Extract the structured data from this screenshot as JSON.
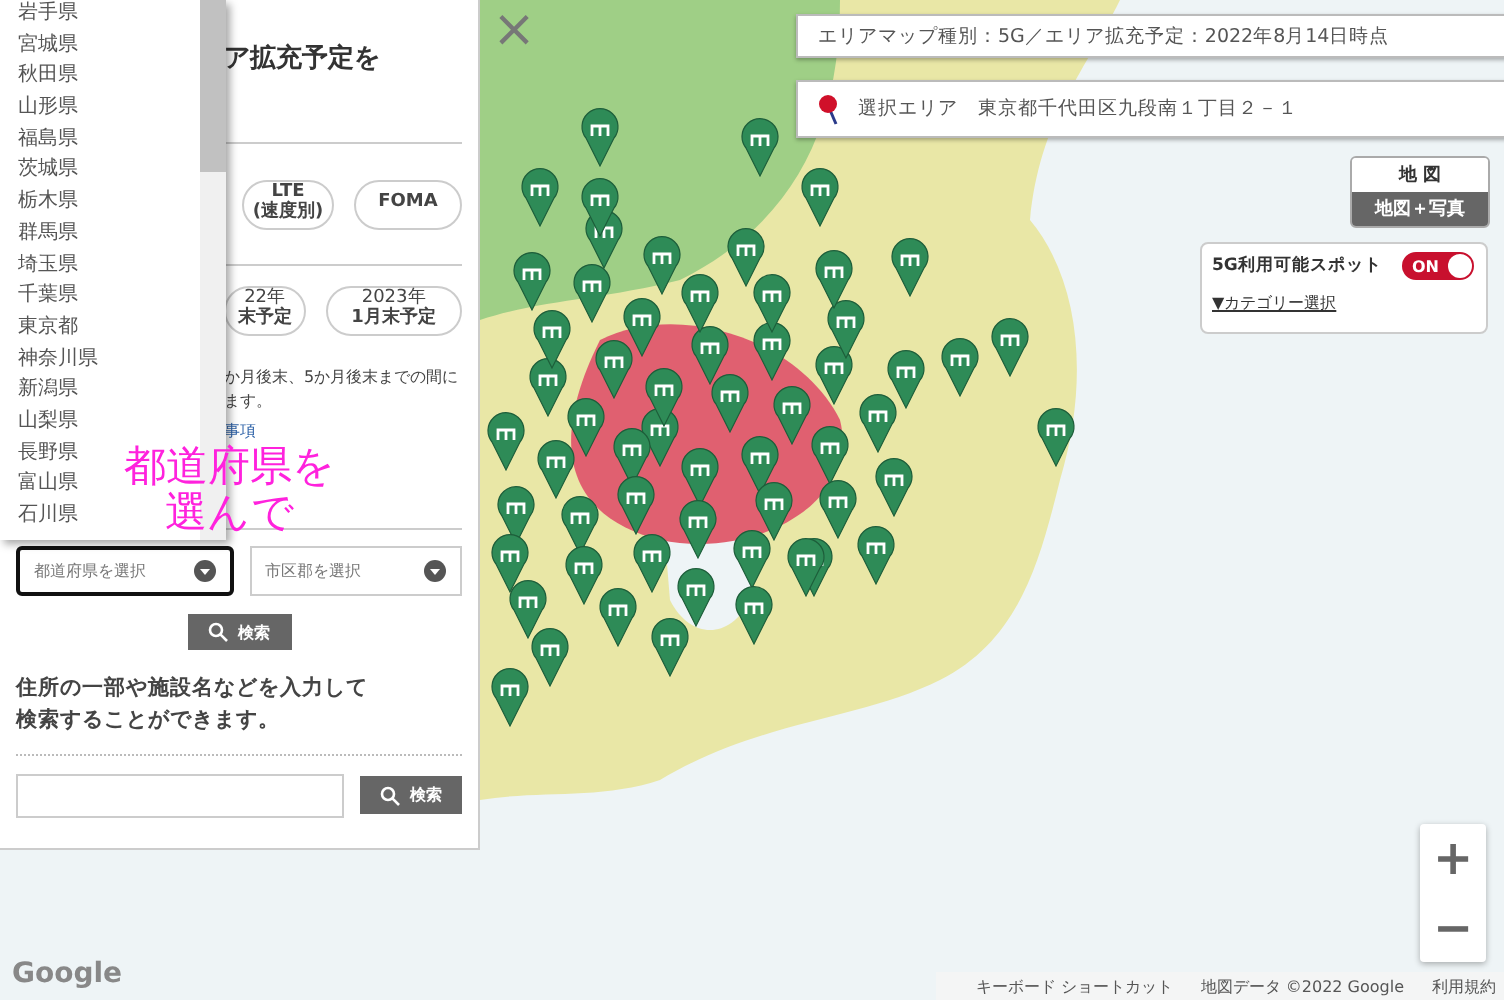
{
  "dropdown": {
    "items": [
      "岩手県",
      "宮城県",
      "秋田県",
      "山形県",
      "福島県",
      "茨城県",
      "栃木県",
      "群馬県",
      "埼玉県",
      "千葉県",
      "東京都",
      "神奈川県",
      "新潟県",
      "山梨県",
      "長野県",
      "富山県",
      "石川県"
    ]
  },
  "panel": {
    "title": "ア拡充予定を",
    "networks": [
      {
        "lines": [
          "LTE",
          "(速度別)"
        ]
      },
      {
        "lines": [
          "FOMA"
        ]
      }
    ],
    "dates": [
      {
        "lines": [
          "22年",
          "末予定"
        ]
      },
      {
        "lines": [
          "2023年",
          "1月末予定"
        ]
      }
    ],
    "note": [
      "か月後末、5か月後末までの間に",
      "ます。"
    ],
    "link": "事項",
    "annotation": [
      "都道府県を",
      "選んで"
    ],
    "selects": [
      {
        "placeholder": "都道府県を選択",
        "focused": true
      },
      {
        "placeholder": "市区郡を選択",
        "focused": false
      }
    ],
    "search_button": "検索",
    "hint": [
      "住所の一部や施設名などを入力して",
      "検索することができます。"
    ],
    "free_search_button": "検索"
  },
  "map": {
    "close": "×",
    "info": "エリアマップ種別：5G／エリア拡充予定：2022年8月14日時点",
    "location": "選択エリア　東京都千代田区九段南１丁目２－１",
    "map_types": [
      {
        "label": "地 図",
        "selected": false
      },
      {
        "label": "地図＋写真",
        "selected": true
      }
    ],
    "spot": {
      "label": "5G利用可能スポット",
      "on": true,
      "toggle_text": "ON",
      "link": "▼カテゴリー選択"
    },
    "zoom": [
      "+",
      "−"
    ],
    "logo": "Google",
    "footer": [
      "キーボード ショートカット",
      "地図データ ©2022 Google",
      "利用規約"
    ]
  }
}
